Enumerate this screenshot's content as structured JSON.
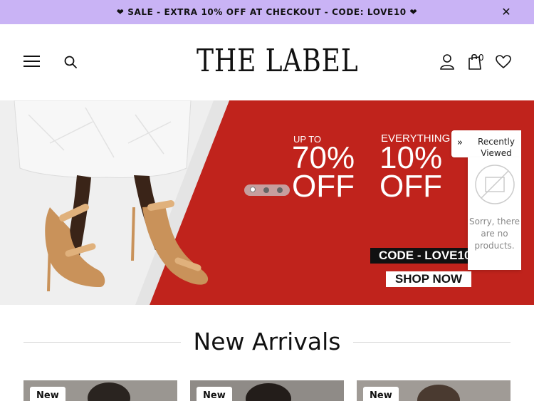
{
  "announcement": {
    "text": "❤ SALE - EXTRA 10% OFF AT CHECKOUT - CODE: LOVE10 ❤",
    "close_icon": "close-icon"
  },
  "header": {
    "logo": "THE LABEL",
    "cart_count": "0",
    "icons": [
      "menu-icon",
      "search-icon",
      "user-icon",
      "shopping-bag-icon",
      "heart-icon"
    ]
  },
  "hero": {
    "promo1_small": "UP TO",
    "promo1_big_line1": "70%",
    "promo1_big_line2": "OFF",
    "promo2_small": "EVERYTHING",
    "promo2_big_line1": "10%",
    "promo2_big_line2": "OFF",
    "code": "CODE - LOVE10",
    "cta": "SHOP NOW",
    "slides": 3,
    "active_slide": 1,
    "accent_color": "#c0231c"
  },
  "recently_viewed": {
    "title": "Recently Viewed",
    "empty_message": "Sorry, there are no products."
  },
  "new_arrivals": {
    "title": "New Arrivals",
    "products": [
      {
        "badge": "New"
      },
      {
        "badge": "New"
      },
      {
        "badge": "New"
      }
    ]
  }
}
